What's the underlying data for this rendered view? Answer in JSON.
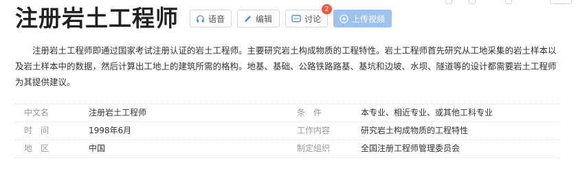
{
  "title": "注册岩土工程师",
  "toolbar": {
    "voice_label": "语音",
    "edit_label": "编辑",
    "discuss_label": "讨论",
    "discuss_count": "2",
    "upload_label": "上传视频"
  },
  "summary": "注册岩土工程师即通过国家考试注册认证的岩土工程师。主要研究岩土构成物质的工程特性。岩土工程师首先研究从工地采集的岩土样本以及岩土样本中的数据，然后计算出工地上的建筑所需的格构。地基、基础、公路铁路路基、基坑和边坡、水坝、隧道等的设计都需要岩土工程师为其提供建议。",
  "info": {
    "left": [
      {
        "label": "中文名",
        "value": "注册岩土工程师"
      },
      {
        "label": "时　间",
        "value": "1998年6月"
      },
      {
        "label": "地　区",
        "value": "中国"
      }
    ],
    "right": [
      {
        "label": "条　件",
        "value": "本专业、相近专业、或其他工科专业"
      },
      {
        "label": "工作内容",
        "value": "研究岩土构成物质的工程特性"
      },
      {
        "label": "制定组织",
        "value": "全国注册工程师管理委员会"
      }
    ]
  },
  "colors": {
    "accent": "#4f8edc",
    "badge": "#f05a3c",
    "upload_bg": "#9dc2ee"
  }
}
